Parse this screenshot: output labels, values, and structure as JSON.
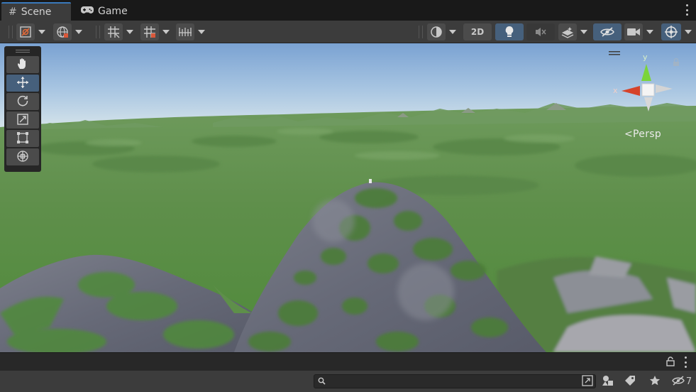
{
  "tabs": [
    {
      "label": "Scene",
      "icon": "hash-icon",
      "active": true
    },
    {
      "label": "Game",
      "icon": "gamepad-icon",
      "active": false
    }
  ],
  "toolbar": {
    "mode_2d_label": "2D",
    "left_tools": [
      "gizmo-tool-icon",
      "global-icon",
      "grid-icon",
      "snap-icon",
      "increment-snap-icon"
    ],
    "right_tools": [
      "shading-mode-icon",
      "lighting-icon",
      "audio-mute-icon",
      "effects-icon",
      "visibility-icon",
      "camera-icon",
      "gizmos-icon"
    ]
  },
  "tools_overlay": {
    "items": [
      {
        "name": "hand-tool",
        "icon": "hand-icon",
        "selected": false
      },
      {
        "name": "move-tool",
        "icon": "move-icon",
        "selected": true
      },
      {
        "name": "rotate-tool",
        "icon": "rotate-icon",
        "selected": false
      },
      {
        "name": "scale-tool",
        "icon": "scale-icon",
        "selected": false
      },
      {
        "name": "rect-tool",
        "icon": "rect-icon",
        "selected": false
      },
      {
        "name": "transform-tool",
        "icon": "transform-icon",
        "selected": false
      }
    ]
  },
  "orientation_gizmo": {
    "y_label": "y",
    "x_label": "x",
    "projection_label": "Persp"
  },
  "bottom": {
    "search_placeholder": "",
    "hidden_count": "7"
  },
  "colors": {
    "accent": "#46607c",
    "tab_underline": "#3a79bb",
    "sky_top": "#7fa6d3",
    "sky_horizon": "#cfe0ea",
    "ground": "#5e8f4c",
    "rock": "#6f7381",
    "gizmo_x": "#d6432a",
    "gizmo_y": "#7bd43a"
  }
}
